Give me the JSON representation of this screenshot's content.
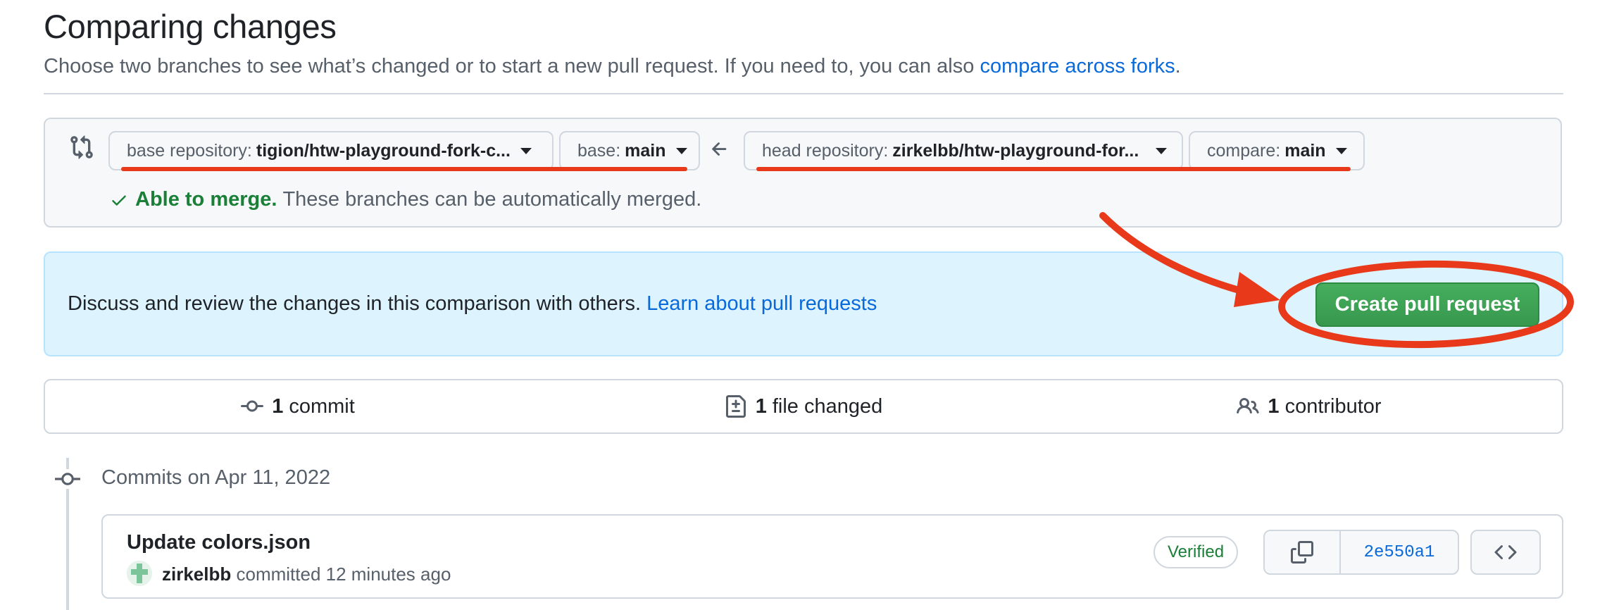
{
  "page": {
    "title": "Comparing changes",
    "subtitle_text": "Choose two branches to see what’s changed or to start a new pull request. If you need to, you can also ",
    "subtitle_link": "compare across forks",
    "subtitle_end": "."
  },
  "range": {
    "base_repo_label": "base repository:",
    "base_repo_value": "tigion/htw-playground-fork-c...",
    "base_label": "base:",
    "base_value": "main",
    "head_repo_label": "head repository:",
    "head_repo_value": "zirkelbb/htw-playground-for...",
    "compare_label": "compare:",
    "compare_value": "main",
    "merge_ok": "Able to merge.",
    "merge_text": "These branches can be automatically merged."
  },
  "discuss": {
    "text": "Discuss and review the changes in this comparison with others. ",
    "link": "Learn about pull requests",
    "button": "Create pull request"
  },
  "stats": {
    "commits_count": "1",
    "commits_label": "commit",
    "files_count": "1",
    "files_label": "file changed",
    "contributors_count": "1",
    "contributors_label": "contributor"
  },
  "commits": {
    "date_heading": "Commits on Apr 11, 2022",
    "items": [
      {
        "title": "Update colors.json",
        "author": "zirkelbb",
        "meta": "committed 12 minutes ago",
        "badge": "Verified",
        "sha": "2e550a1"
      }
    ]
  },
  "colors": {
    "annotation_red": "#e8391b",
    "primary_button": "#3aa153",
    "link": "#0969da"
  }
}
